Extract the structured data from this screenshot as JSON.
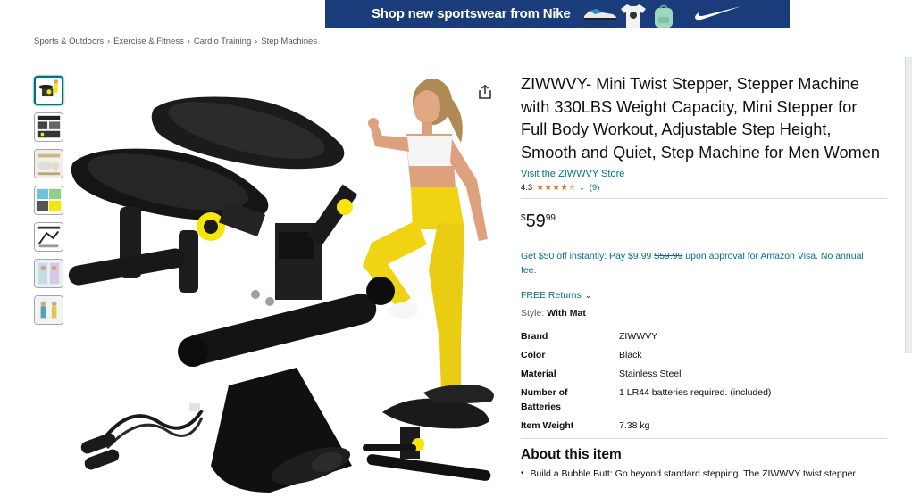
{
  "ad": {
    "text": "Shop new sportswear from Nike",
    "brand_color": "#1a3c7a"
  },
  "breadcrumb": [
    "Sports & Outdoors",
    "Exercise & Fitness",
    "Cardio Training",
    "Step Machines"
  ],
  "breadcrumb_separator": "›",
  "gallery": {
    "thumbnails": 7,
    "icons": {
      "share": "share-icon"
    }
  },
  "product": {
    "title": "ZIWWVY- Mini Twist Stepper, Stepper Machine with 330LBS Weight Capacity, Mini Stepper for Full Body Workout, Adjustable Step Height, Smooth and Quiet, Step Machine for Men Women",
    "store_link": "Visit the ZIWWVY Store",
    "rating_value": "4.3",
    "rating_stars": 4.3,
    "review_count": "(9)",
    "price_symbol": "$",
    "price_whole": "59",
    "price_fraction": "99",
    "promo_prefix": "Get $50 off instantly: Pay $9.99",
    "promo_strike": "$59.99",
    "promo_suffix": "upon approval for Amazon Visa. No annual fee.",
    "returns_label": "FREE Returns",
    "style_label": "Style:",
    "style_value": "With Mat"
  },
  "specs": [
    {
      "key": "Brand",
      "value": "ZIWWVY"
    },
    {
      "key": "Color",
      "value": "Black"
    },
    {
      "key": "Material",
      "value": "Stainless Steel"
    },
    {
      "key": "Number of Batteries",
      "value": "1 LR44 batteries required. (included)"
    },
    {
      "key": "Item Weight",
      "value": "7.38 kg"
    }
  ],
  "about": {
    "title": "About this item",
    "bullets": [
      "Build a Bubble Butt: Go beyond standard stepping. The ZIWWVY twist stepper"
    ]
  },
  "colors": {
    "link": "#007185",
    "star": "#de7921",
    "text": "#0f1111",
    "muted": "#565959",
    "accent_yellow": "#f5e60a"
  }
}
